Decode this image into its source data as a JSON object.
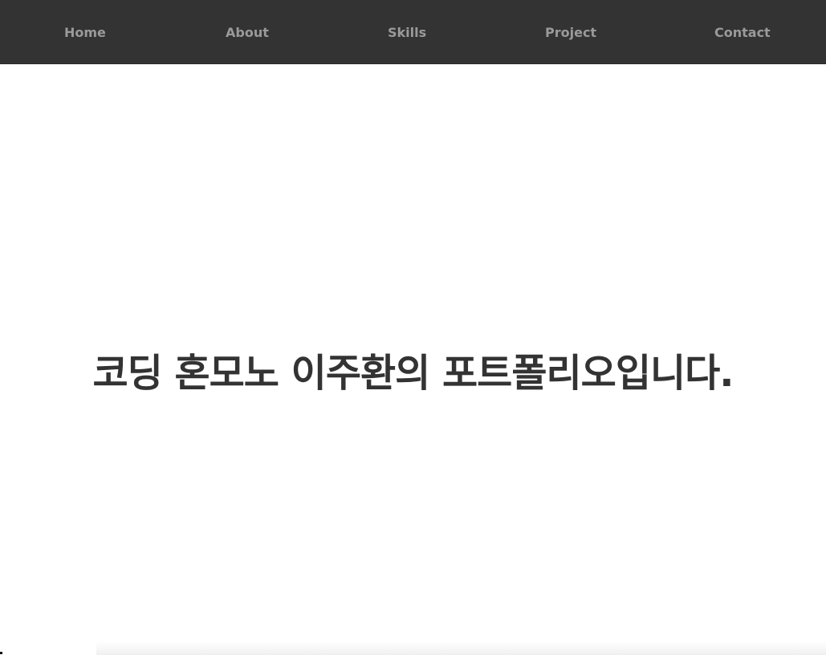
{
  "nav": {
    "items": [
      {
        "label": "Home"
      },
      {
        "label": "About"
      },
      {
        "label": "Skills"
      },
      {
        "label": "Project"
      },
      {
        "label": "Contact"
      }
    ]
  },
  "hero": {
    "title": "코딩 혼모노 이주환의 포트폴리오입니다."
  },
  "colors": {
    "nav_background": "#333333",
    "nav_text": "#9a9a9a",
    "hero_text": "#333333",
    "page_background": "#ffffff"
  }
}
